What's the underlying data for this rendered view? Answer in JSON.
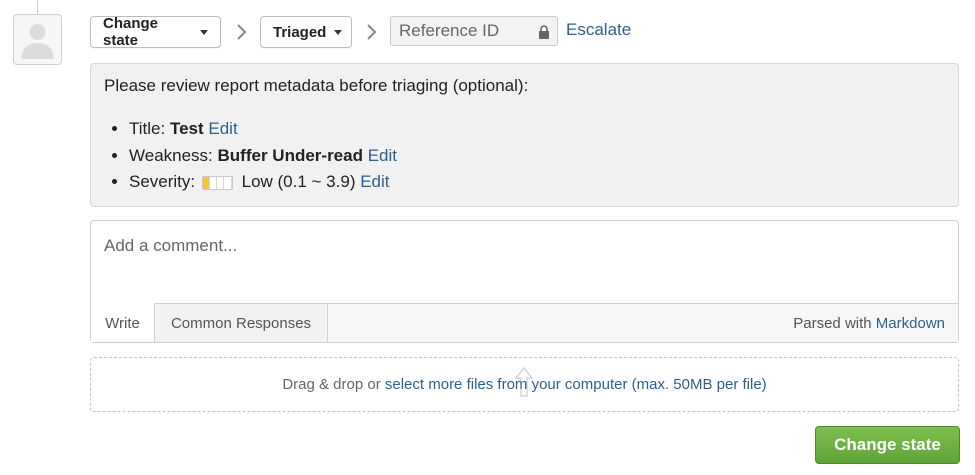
{
  "toolbar": {
    "state_dropdown_label": "Change state",
    "selected_state_label": "Triaged",
    "reference_placeholder": "Reference ID",
    "escalate_label": "Escalate"
  },
  "metadata": {
    "intro": "Please review report metadata before triaging (optional):",
    "items": [
      {
        "key": "Title:",
        "value": "Test",
        "edit": "Edit"
      },
      {
        "key": "Weakness:",
        "value": "Buffer Under-read",
        "edit": "Edit"
      },
      {
        "key": "Severity:",
        "value": "Low (0.1 ~ 3.9)",
        "edit": "Edit",
        "severity_level_filled": 1,
        "severity_level_total": 4,
        "severity_color": "#f5c242"
      }
    ]
  },
  "comment": {
    "placeholder": "Add a comment...",
    "tabs": [
      "Write",
      "Common Responses"
    ],
    "parsed_prefix": "Parsed with",
    "parsed_link": "Markdown"
  },
  "upload": {
    "prefix": "Drag & drop or",
    "link": "select more files from your computer (max. 50MB per file)"
  },
  "submit_label": "Change state",
  "colors": {
    "link": "#2f5f8f",
    "submit_bg": "#6db043",
    "meta_bg": "#f1f1f1"
  }
}
